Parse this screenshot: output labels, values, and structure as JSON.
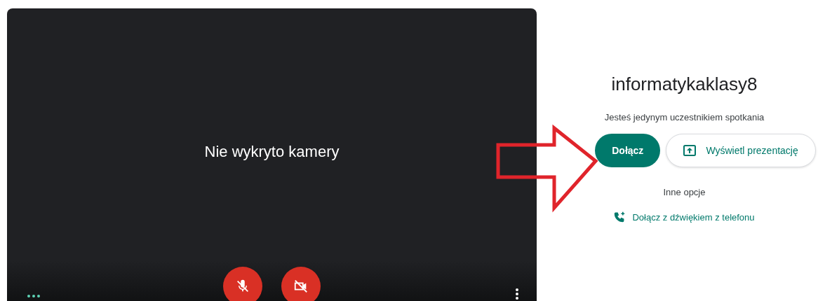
{
  "preview": {
    "message": "Nie wykryto kamery",
    "microphone": {
      "on": false
    },
    "camera": {
      "on": false
    }
  },
  "meeting": {
    "name": "informatykaklasy8",
    "status": "Jesteś jedynym uczestnikiem spotkania",
    "join_button": "Dołącz",
    "present_button": "Wyświetl prezentację",
    "other_options": "Inne opcje",
    "phone_link": "Dołącz z dźwiękiem z telefonu"
  }
}
